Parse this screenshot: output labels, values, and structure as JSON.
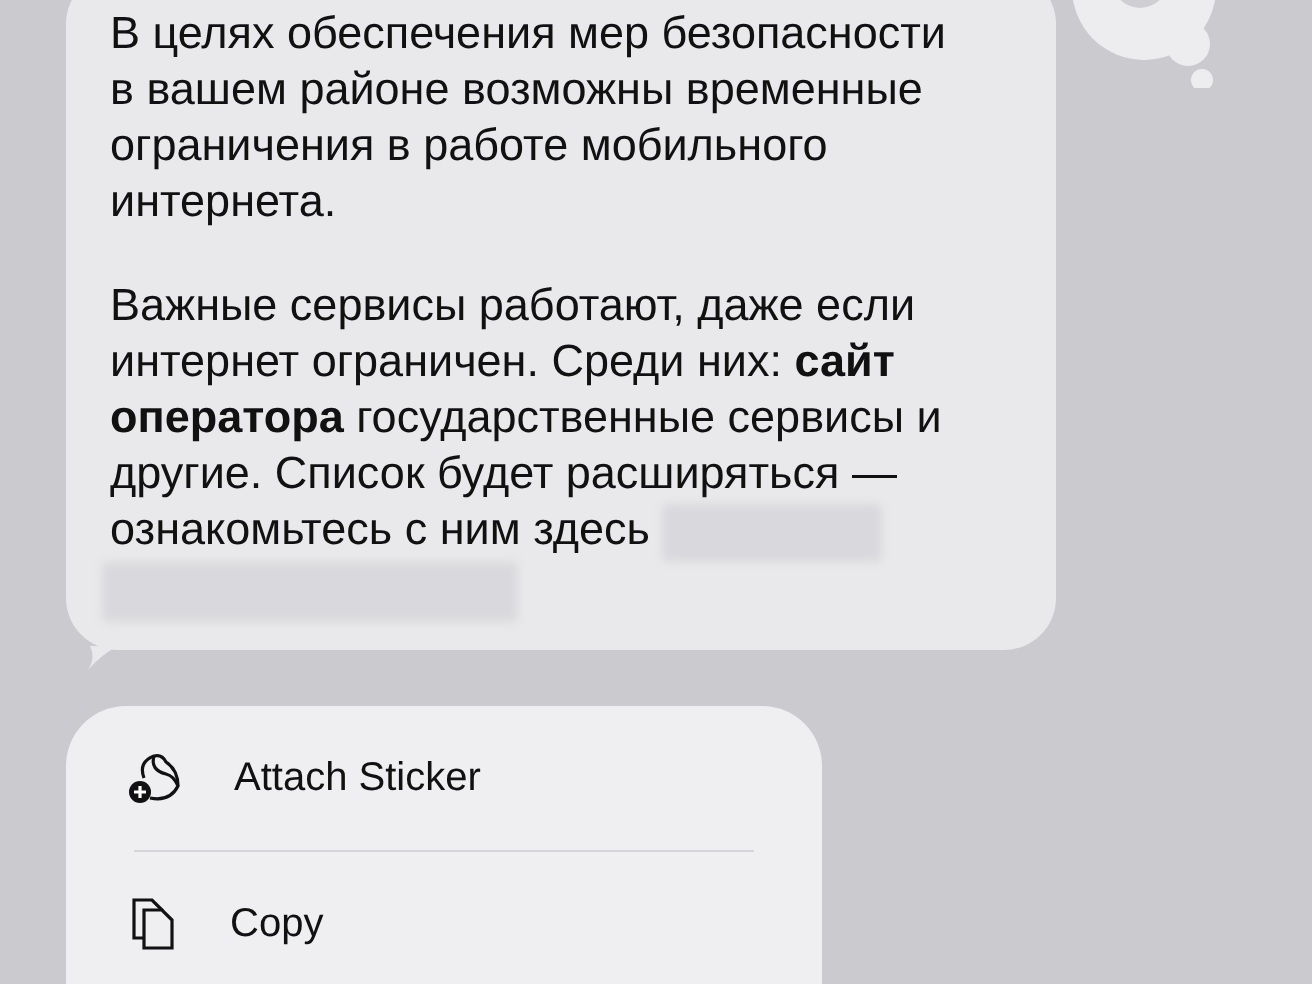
{
  "message": {
    "paragraphs": [
      "В целях обеспечения мер безопасности в вашем районе возможны временные ограничения в работе мобильного интернета.",
      "Важные сервисы работают, даже если интернет ограничен. Среди них: **сайт оператора** государственные сервисы и другие. Список будет расширяться — ознакомьтесь с ним здесь"
    ]
  },
  "context_menu": {
    "items": [
      {
        "label": "Attach Sticker",
        "kind": "sticker"
      },
      {
        "label": "Copy",
        "kind": "copy"
      }
    ]
  }
}
